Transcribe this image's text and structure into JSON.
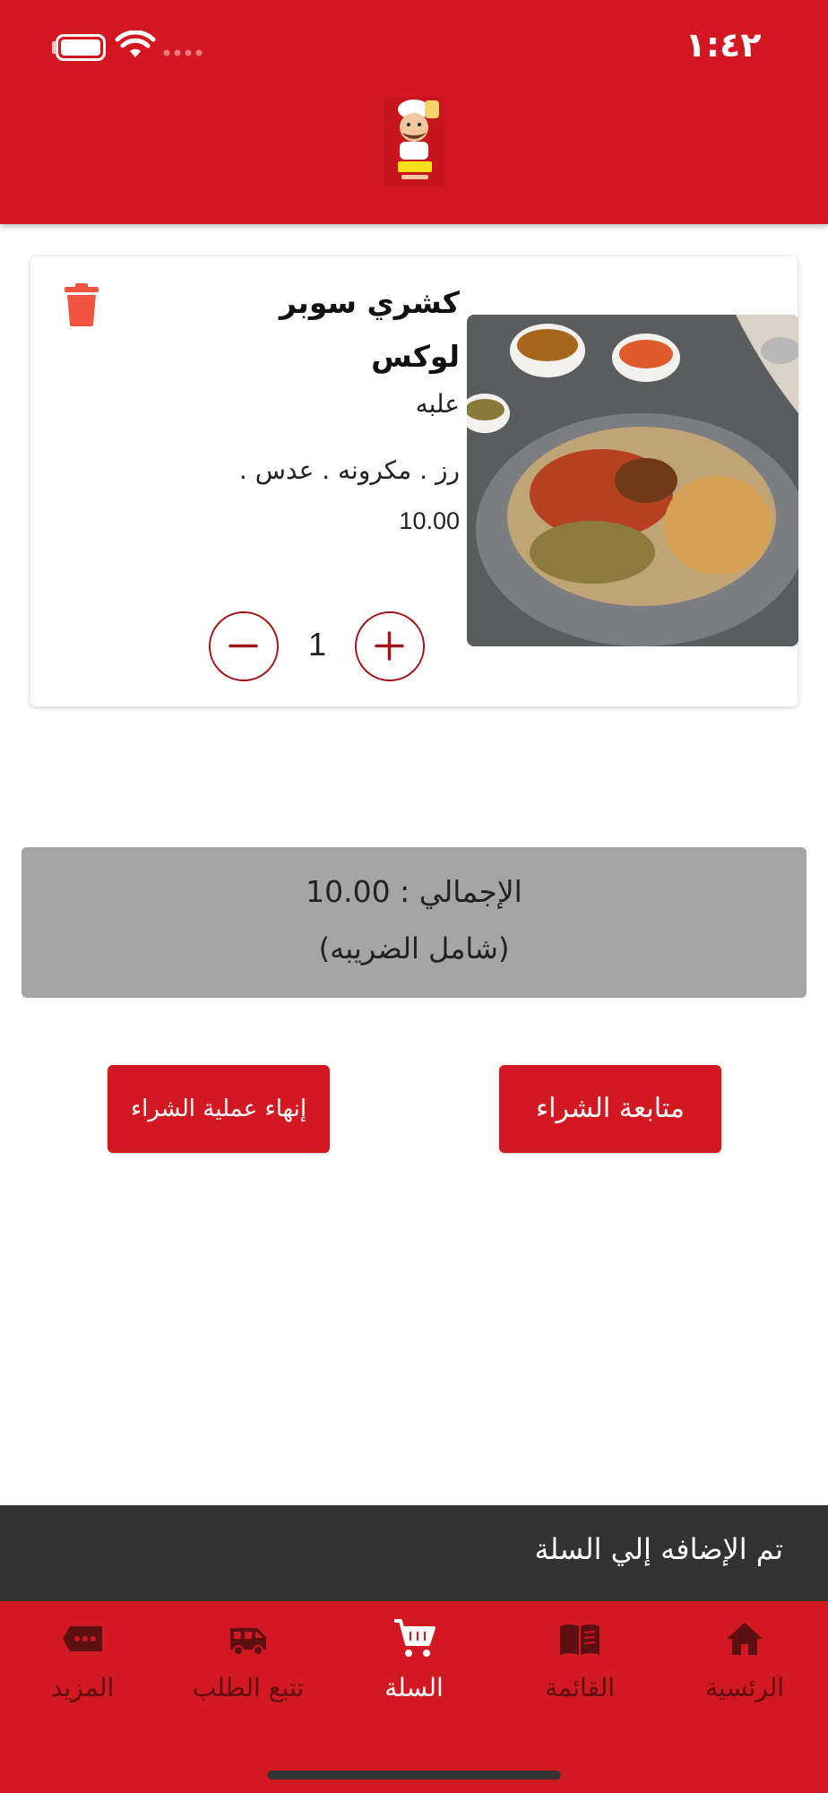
{
  "status_bar": {
    "time": "١:٤٢",
    "battery_icon": "battery-icon",
    "wifi_icon": "wifi-icon"
  },
  "header": {
    "logo_icon": "koshary-el-zaeem-logo"
  },
  "cart_item": {
    "name": "كشري سوبر لوكس",
    "variant": "علبه",
    "description": "رز . مكرونه . عدس .",
    "price": "10.00",
    "quantity": "1",
    "delete_icon": "trash-icon"
  },
  "total": {
    "line": "الإجمالي : 10.00",
    "note": "(شامل الضريبه)"
  },
  "actions": {
    "continue_label": "متابعة الشراء",
    "finish_label": "إنهاء عملية الشراء"
  },
  "snackbar": {
    "message": "تم الإضافه إلي السلة"
  },
  "bottom_nav": {
    "items": [
      {
        "label": "الرئسية",
        "icon": "home-icon"
      },
      {
        "label": "القائمة",
        "icon": "menu-book-icon"
      },
      {
        "label": "السلة",
        "icon": "cart-icon",
        "active": true
      },
      {
        "label": "تتبع الطلب",
        "icon": "delivery-van-icon"
      },
      {
        "label": "المزيد",
        "icon": "more-icon"
      }
    ]
  },
  "colors": {
    "primary": "#d21820",
    "inactive_nav": "#5e0f12",
    "total_background": "#a5a5a5",
    "snackbar": "#323232"
  }
}
